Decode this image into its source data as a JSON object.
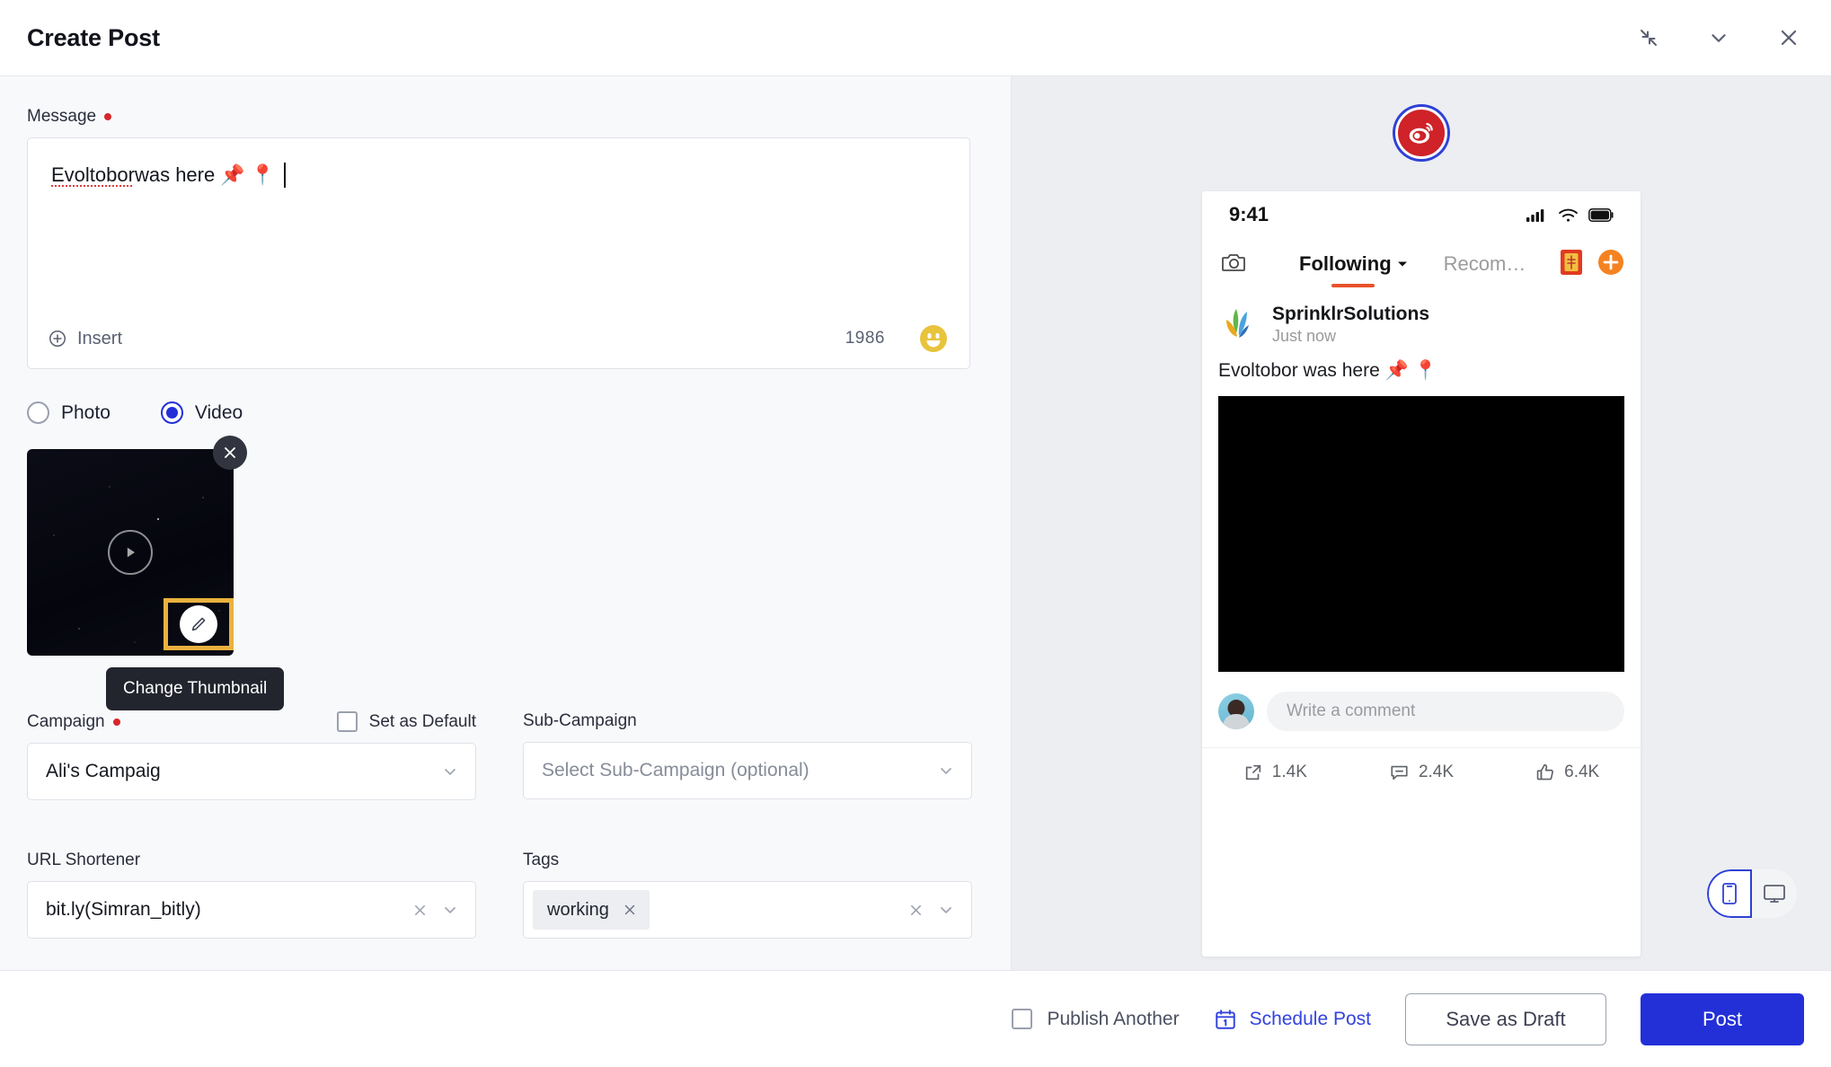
{
  "header": {
    "title": "Create Post",
    "minimize_icon": "collapse-icon",
    "chevron_icon": "chevron-down-icon",
    "close_icon": "close-icon"
  },
  "form": {
    "message": {
      "label": "Message",
      "required": true,
      "value_misspelled": "Evoltobor",
      "value_rest": " was here 📌 📍",
      "insert_label": "Insert",
      "char_count": "1986",
      "emoji_icon": "emoji-smiley-icon"
    },
    "media_type": {
      "options": [
        {
          "label": "Photo",
          "selected": false
        },
        {
          "label": "Video",
          "selected": true
        }
      ]
    },
    "media": {
      "remove_icon": "close-icon",
      "play_icon": "play-icon",
      "edit_icon": "pencil-icon",
      "tooltip": "Change Thumbnail"
    },
    "campaign": {
      "label": "Campaign",
      "required": true,
      "set_default_label": "Set as Default",
      "set_default_checked": false,
      "value": "Ali's Campaig"
    },
    "sub_campaign": {
      "label": "Sub-Campaign",
      "placeholder": "Select Sub-Campaign (optional)"
    },
    "url_shortener": {
      "label": "URL Shortener",
      "value": "bit.ly(Simran_bitly)"
    },
    "tags": {
      "label": "Tags",
      "chips": [
        "working"
      ]
    }
  },
  "preview": {
    "channel": "weibo-logo",
    "status_bar": {
      "time": "9:41",
      "signal_icon": "cellular-signal-icon",
      "wifi_icon": "wifi-icon",
      "battery_icon": "battery-icon"
    },
    "tabs": {
      "camera_icon": "camera-icon",
      "active": "Following",
      "inactive": "Recom…",
      "gift_icon": "red-envelope-icon",
      "plus_icon": "plus-icon"
    },
    "post": {
      "author": "SprinklrSolutions",
      "time": "Just now",
      "text": "Evoltobor was here 📌 📍"
    },
    "comment_placeholder": "Write a comment",
    "stats": [
      {
        "icon": "share-icon",
        "value": "1.4K"
      },
      {
        "icon": "comment-icon",
        "value": "2.4K"
      },
      {
        "icon": "thumbs-up-icon",
        "value": "6.4K"
      }
    ],
    "device_toggle": {
      "mobile_icon": "mobile-icon",
      "desktop_icon": "desktop-icon",
      "selected": "mobile"
    }
  },
  "footer": {
    "publish_another_label": "Publish Another",
    "publish_another_checked": false,
    "schedule_label": "Schedule Post",
    "schedule_icon": "calendar-icon",
    "save_draft_label": "Save as Draft",
    "post_label": "Post"
  },
  "colors": {
    "primary": "#2330d8",
    "link": "#3243e0",
    "required": "#d7262b",
    "highlight": "#eab13e",
    "weibo": "#cf2229",
    "accent_orange": "#e8522a"
  }
}
